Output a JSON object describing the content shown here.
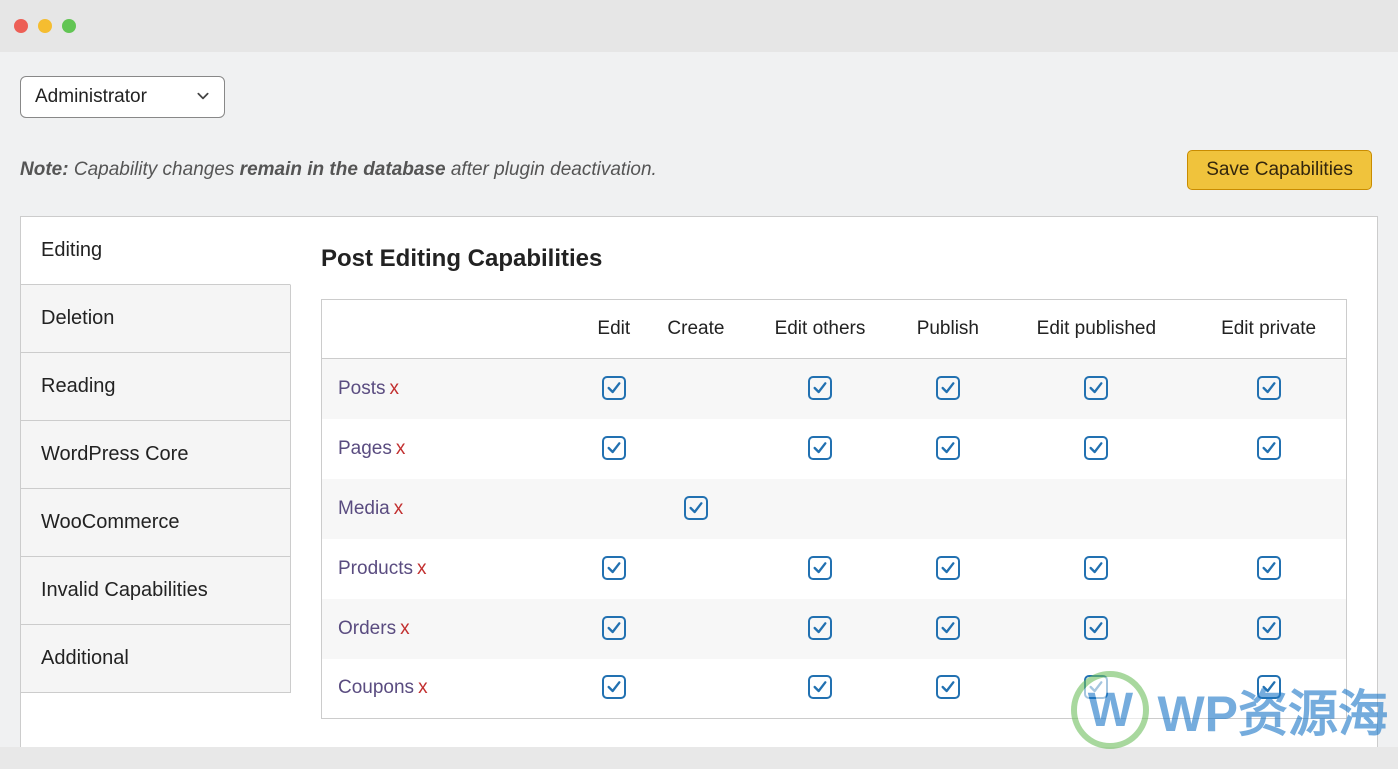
{
  "role_select": {
    "value": "Administrator"
  },
  "note": {
    "prefix": "Note:",
    "part1": "Capability changes",
    "strong": "remain in the database",
    "part2": "after plugin deactivation."
  },
  "save_button": "Save Capabilities",
  "tabs": [
    "Editing",
    "Deletion",
    "Reading",
    "WordPress Core",
    "WooCommerce",
    "Invalid Capabilities",
    "Additional"
  ],
  "content_title": "Post Editing Capabilities",
  "columns": [
    "",
    "Edit",
    "Create",
    "Edit others",
    "Publish",
    "Edit published",
    "Edit private"
  ],
  "rows": [
    {
      "label": "Posts",
      "x": "x",
      "checks": [
        true,
        false,
        true,
        true,
        true,
        true
      ]
    },
    {
      "label": "Pages",
      "x": "x",
      "checks": [
        true,
        false,
        true,
        true,
        true,
        true
      ]
    },
    {
      "label": "Media",
      "x": "x",
      "checks": [
        false,
        true,
        false,
        false,
        false,
        false
      ]
    },
    {
      "label": "Products",
      "x": "x",
      "checks": [
        true,
        false,
        true,
        true,
        true,
        true
      ]
    },
    {
      "label": "Orders",
      "x": "x",
      "checks": [
        true,
        false,
        true,
        true,
        true,
        true
      ]
    },
    {
      "label": "Coupons",
      "x": "x",
      "checks": [
        true,
        false,
        true,
        true,
        true,
        true
      ]
    }
  ],
  "watermark": {
    "logo_letter": "W",
    "text": "WP资源海"
  }
}
